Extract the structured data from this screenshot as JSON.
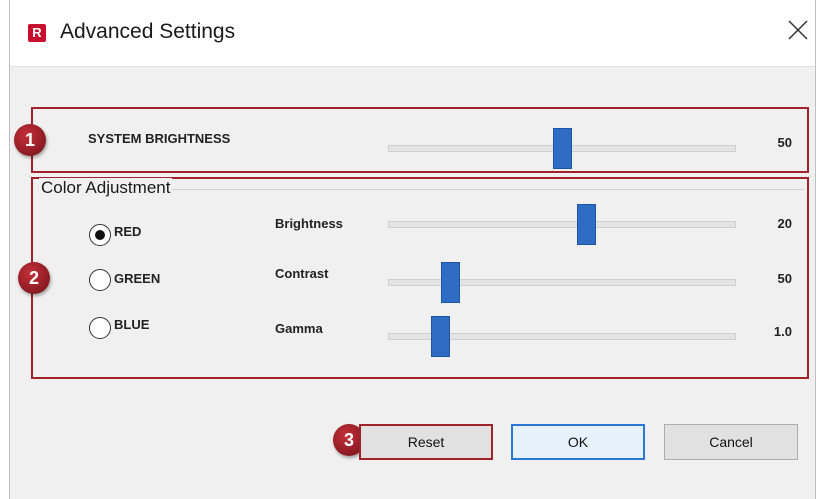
{
  "window": {
    "title": "Advanced Settings",
    "logo_letter": "R",
    "close_icon": "close-icon"
  },
  "callouts": {
    "one": "1",
    "two": "2",
    "three": "3"
  },
  "system": {
    "label": "SYSTEM BRIGHTNESS",
    "value": "50",
    "level": 0.5
  },
  "color_adjustment": {
    "legend": "Color Adjustment",
    "radios": [
      {
        "label": "RED",
        "selected": true
      },
      {
        "label": "GREEN",
        "selected": false
      },
      {
        "label": "BLUE",
        "selected": false
      }
    ],
    "sliders": [
      {
        "label": "Brightness",
        "value": "20",
        "level": 0.57
      },
      {
        "label": "Contrast",
        "value": "50",
        "level": 0.18
      },
      {
        "label": "Gamma",
        "value": "1.0",
        "level": 0.15
      }
    ]
  },
  "buttons": {
    "reset": "Reset",
    "ok": "OK",
    "cancel": "Cancel"
  },
  "colors": {
    "accent": "#2f6dc4",
    "callout": "#a0222a",
    "ok_border": "#2b77d6"
  }
}
